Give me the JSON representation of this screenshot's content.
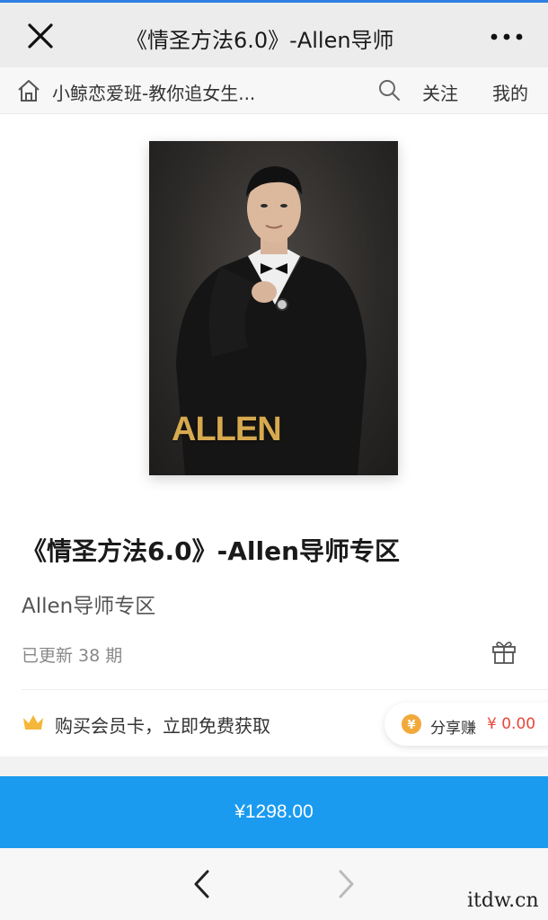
{
  "titlebar": {
    "title": "《情圣方法6.0》-Allen导师",
    "close_icon": "close-icon",
    "more_icon": "more-icon"
  },
  "navbar": {
    "shop_name": "小鲸恋爱班-教你追女生...",
    "follow": "关注",
    "mine": "我的",
    "home_icon": "home-icon",
    "search_icon": "search-icon"
  },
  "cover": {
    "text": "ALLEN"
  },
  "product": {
    "title": "《情圣方法6.0》-Allen导师专区",
    "subtitle": "Allen导师专区",
    "updated": "已更新 38 期",
    "gift_icon": "gift-icon"
  },
  "member": {
    "text": "购买会员卡，立即免费获取",
    "crown_icon": "crown-icon",
    "crown_color": "#f4b73a"
  },
  "share": {
    "label": "分享赚",
    "amount": "¥ 0.00",
    "coin_color": "#f2a93b",
    "amount_color": "#e8463a"
  },
  "buy": {
    "price_label": "¥1298.00",
    "color": "#1a9bf0"
  },
  "bottom_nav": {
    "back_icon": "chevron-left-icon",
    "forward_icon": "chevron-right-icon"
  },
  "watermark": "itdw.cn"
}
